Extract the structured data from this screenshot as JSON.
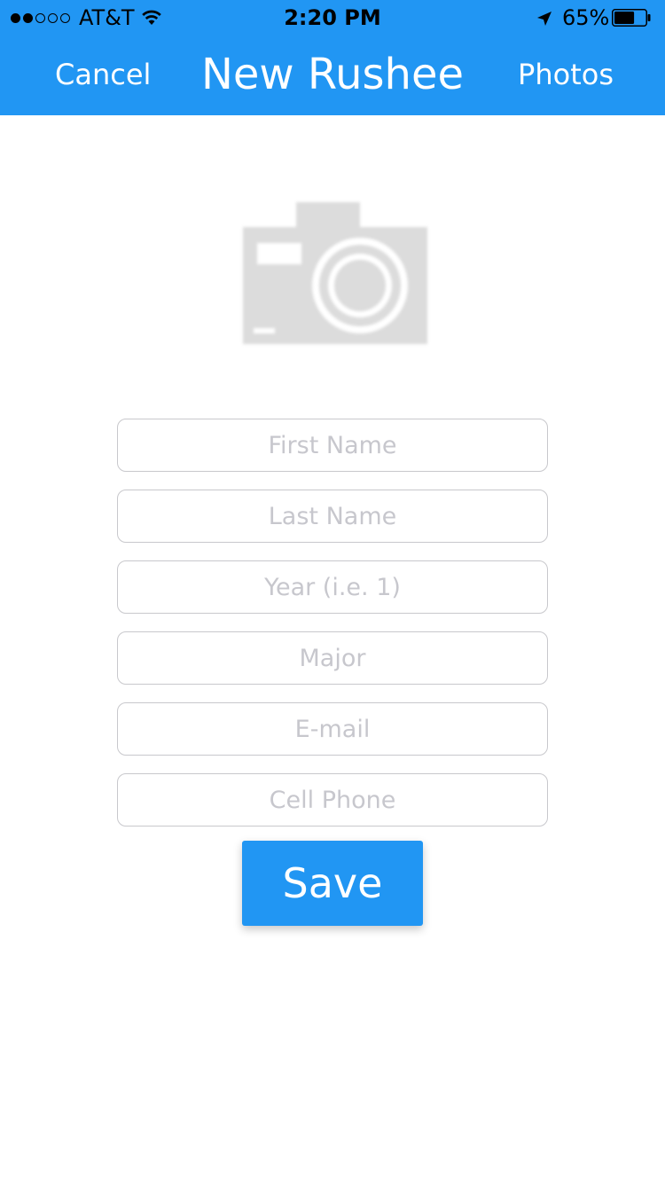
{
  "status_bar": {
    "signal_bars": 2,
    "signal_total": 5,
    "carrier": "AT&T",
    "wifi_icon": "wifi-icon",
    "time": "2:20 PM",
    "location_icon": "location-arrow-icon",
    "battery_percent": "65%",
    "battery_level": 0.65,
    "battery_icon": "battery-icon"
  },
  "nav": {
    "left_label": "Cancel",
    "title": "New Rushee",
    "right_label": "Photos"
  },
  "photo": {
    "icon": "camera-icon"
  },
  "form": {
    "fields": [
      {
        "placeholder": "First Name",
        "value": ""
      },
      {
        "placeholder": "Last Name",
        "value": ""
      },
      {
        "placeholder": "Year (i.e. 1)",
        "value": ""
      },
      {
        "placeholder": "Major",
        "value": ""
      },
      {
        "placeholder": "E-mail",
        "value": ""
      },
      {
        "placeholder": "Cell Phone",
        "value": ""
      }
    ],
    "save_label": "Save"
  },
  "colors": {
    "accent": "#2196F3",
    "placeholder_text": "#c7c7cd",
    "field_border": "#c8c8cc",
    "camera_gray": "#dcdcdc"
  }
}
